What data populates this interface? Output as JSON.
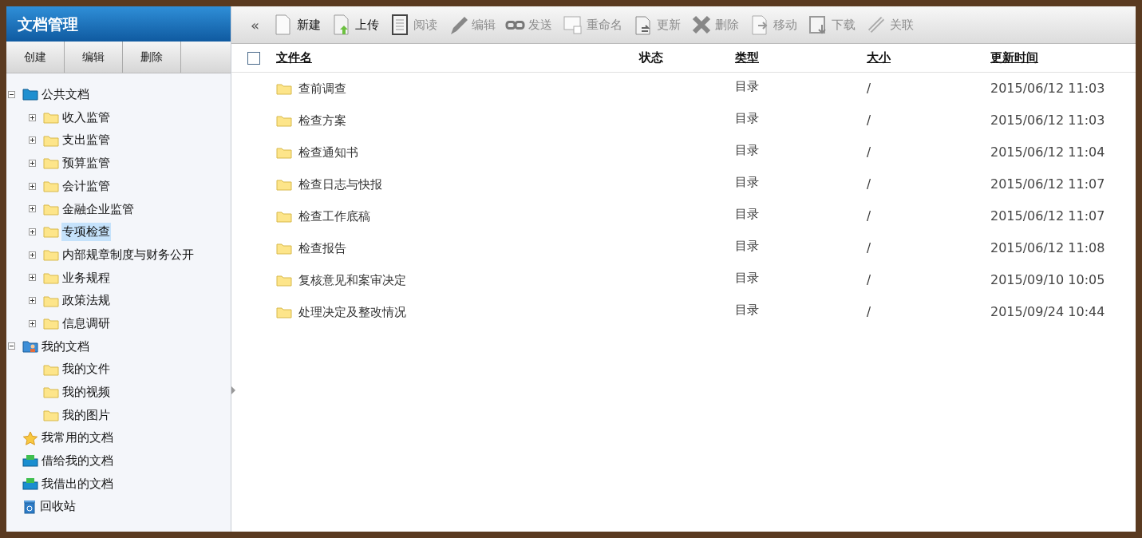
{
  "sidebar": {
    "title": "文档管理",
    "actions": [
      "创建",
      "编辑",
      "删除"
    ],
    "tree": [
      {
        "label": "公共文档",
        "kind": "public",
        "expanded": true,
        "selected": false,
        "children": [
          {
            "label": "收入监管",
            "kind": "folder",
            "expanded": false,
            "selected": false
          },
          {
            "label": "支出监管",
            "kind": "folder",
            "expanded": false,
            "selected": false
          },
          {
            "label": "预算监管",
            "kind": "folder",
            "expanded": false,
            "selected": false
          },
          {
            "label": "会计监管",
            "kind": "folder",
            "expanded": false,
            "selected": false
          },
          {
            "label": "金融企业监管",
            "kind": "folder",
            "expanded": false,
            "selected": false
          },
          {
            "label": "专项检查",
            "kind": "folder",
            "expanded": false,
            "selected": true
          },
          {
            "label": "内部规章制度与财务公开",
            "kind": "folder",
            "expanded": false,
            "selected": false
          },
          {
            "label": "业务规程",
            "kind": "folder",
            "expanded": false,
            "selected": false
          },
          {
            "label": "政策法规",
            "kind": "folder",
            "expanded": false,
            "selected": false
          },
          {
            "label": "信息调研",
            "kind": "folder",
            "expanded": false,
            "selected": false
          }
        ]
      },
      {
        "label": "我的文档",
        "kind": "mydocs",
        "expanded": true,
        "selected": false,
        "children": [
          {
            "label": "我的文件",
            "kind": "folder",
            "selected": false
          },
          {
            "label": "我的视频",
            "kind": "folder",
            "selected": false
          },
          {
            "label": "我的图片",
            "kind": "folder",
            "selected": false
          }
        ]
      },
      {
        "label": "我常用的文档",
        "kind": "star",
        "selected": false
      },
      {
        "label": "借给我的文档",
        "kind": "tray",
        "selected": false
      },
      {
        "label": "我借出的文档",
        "kind": "tray",
        "selected": false
      },
      {
        "label": "回收站",
        "kind": "recycle",
        "selected": false
      }
    ]
  },
  "toolbar": {
    "collapse": "«",
    "buttons": [
      {
        "label": "新建",
        "kind": "new",
        "disabled": false
      },
      {
        "label": "上传",
        "kind": "upload",
        "disabled": false
      },
      {
        "label": "阅读",
        "kind": "read",
        "disabled": true
      },
      {
        "label": "编辑",
        "kind": "edit",
        "disabled": true
      },
      {
        "label": "发送",
        "kind": "send",
        "disabled": true
      },
      {
        "label": "重命名",
        "kind": "rename",
        "disabled": true
      },
      {
        "label": "更新",
        "kind": "update",
        "disabled": true
      },
      {
        "label": "删除",
        "kind": "delete",
        "disabled": true
      },
      {
        "label": "移动",
        "kind": "move",
        "disabled": true
      },
      {
        "label": "下载",
        "kind": "download",
        "disabled": true
      },
      {
        "label": "关联",
        "kind": "link",
        "disabled": true
      }
    ]
  },
  "table": {
    "select_all_checked": false,
    "columns": [
      "文件名",
      "状态",
      "类型",
      "大小",
      "更新时间"
    ],
    "rows": [
      {
        "name": "查前调查",
        "status": "",
        "type": "目录",
        "size": "/",
        "updated": "2015/06/12 11:03"
      },
      {
        "name": "检查方案",
        "status": "",
        "type": "目录",
        "size": "/",
        "updated": "2015/06/12 11:03"
      },
      {
        "name": "检查通知书",
        "status": "",
        "type": "目录",
        "size": "/",
        "updated": "2015/06/12 11:04"
      },
      {
        "name": "检查日志与快报",
        "status": "",
        "type": "目录",
        "size": "/",
        "updated": "2015/06/12 11:07"
      },
      {
        "name": "检查工作底稿",
        "status": "",
        "type": "目录",
        "size": "/",
        "updated": "2015/06/12 11:07"
      },
      {
        "name": "检查报告",
        "status": "",
        "type": "目录",
        "size": "/",
        "updated": "2015/06/12 11:08"
      },
      {
        "name": "复核意见和案审决定",
        "status": "",
        "type": "目录",
        "size": "/",
        "updated": "2015/09/10 10:05"
      },
      {
        "name": "处理决定及整改情况",
        "status": "",
        "type": "目录",
        "size": "/",
        "updated": "2015/09/24 10:44"
      }
    ]
  }
}
